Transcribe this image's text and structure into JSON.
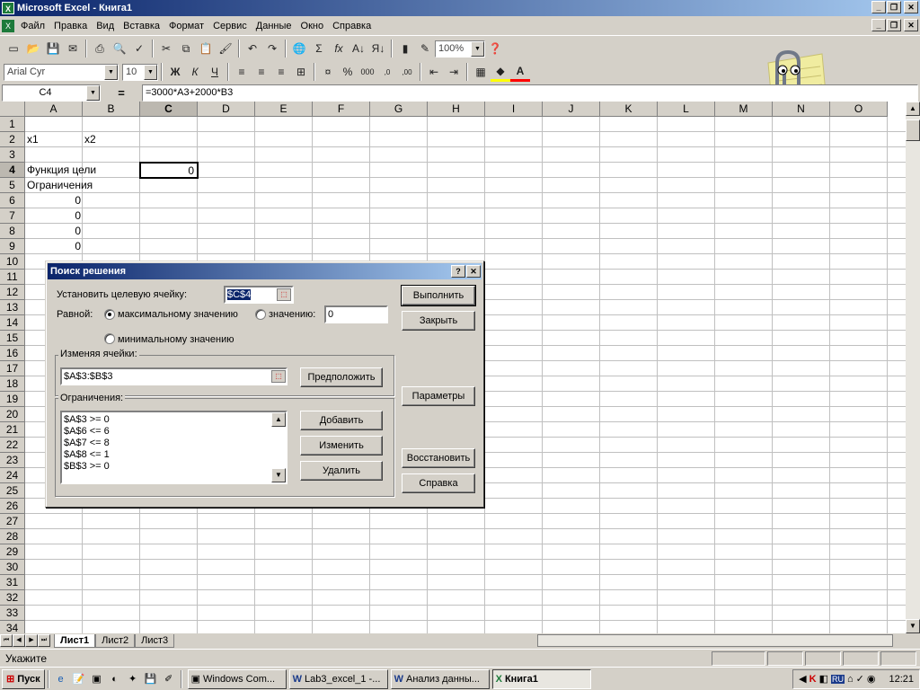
{
  "window": {
    "title": "Microsoft Excel - Книга1"
  },
  "menu": [
    "Файл",
    "Правка",
    "Вид",
    "Вставка",
    "Формат",
    "Сервис",
    "Данные",
    "Окно",
    "Справка"
  ],
  "toolbar": {
    "zoom": "100%",
    "font": "Arial Cyr",
    "font_size": "10",
    "bold": "Ж",
    "italic": "К",
    "underline": "Ч"
  },
  "formula_bar": {
    "cell_ref": "C4",
    "equals": "=",
    "formula": "=3000*A3+2000*B3"
  },
  "columns": [
    "A",
    "B",
    "C",
    "D",
    "E",
    "F",
    "G",
    "H",
    "I",
    "J",
    "K",
    "L",
    "M",
    "N",
    "O"
  ],
  "rows": [
    "1",
    "2",
    "3",
    "4",
    "5",
    "6",
    "7",
    "8",
    "9",
    "10",
    "11",
    "12",
    "13",
    "14",
    "15",
    "16",
    "17",
    "18",
    "19",
    "20",
    "21",
    "22",
    "23",
    "24",
    "25",
    "26",
    "27",
    "28",
    "29",
    "30",
    "31",
    "32",
    "33",
    "34"
  ],
  "cells": {
    "a2": "x1",
    "b2": "x2",
    "a4": "Функция цели",
    "c4": "0",
    "a5": "Ограничения",
    "a6": "0",
    "a7": "0",
    "a8": "0",
    "a9": "0"
  },
  "sheet_tabs": [
    "Лист1",
    "Лист2",
    "Лист3"
  ],
  "status": {
    "text": "Укажите"
  },
  "taskbar": {
    "start": "Пуск",
    "buttons": [
      "Windows Com...",
      "Lab3_excel_1 -...",
      "Анализ данны...",
      "Книга1"
    ],
    "lang": "RU",
    "clock": "12:21"
  },
  "solver": {
    "title": "Поиск решения",
    "target_label": "Установить целевую ячейку:",
    "target_value": "$C$4",
    "equal_label": "Равной:",
    "opt_max": "максимальному значению",
    "opt_value": "значению:",
    "opt_value_field": "0",
    "opt_min": "минимальному значению",
    "changing_label": "Изменяя ячейки:",
    "changing_value": "$A$3:$B$3",
    "guess_btn": "Предположить",
    "constraints_label": "Ограничения:",
    "constraints": [
      "$A$3 >= 0",
      "$A$6 <= 6",
      "$A$7 <= 8",
      "$A$8 <= 1",
      "$B$3 >= 0"
    ],
    "add_btn": "Добавить",
    "change_btn": "Изменить",
    "delete_btn": "Удалить",
    "solve_btn": "Выполнить",
    "close_btn": "Закрыть",
    "options_btn": "Параметры",
    "reset_btn": "Восстановить",
    "help_btn": "Справка",
    "help_q": "?",
    "close_x": "✕"
  }
}
